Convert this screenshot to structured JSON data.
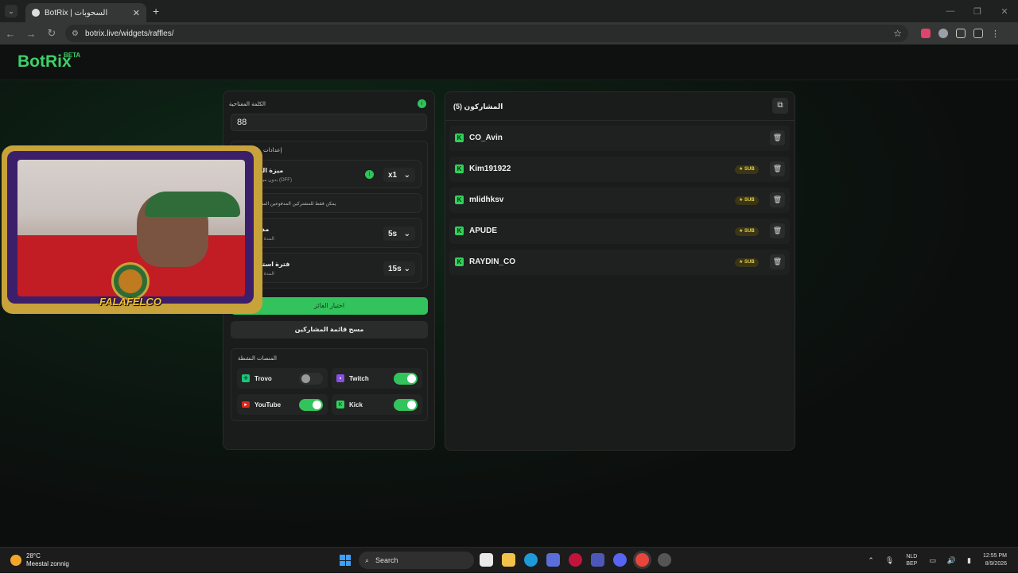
{
  "browser": {
    "tab_title": "BotRix | السحوبات",
    "url": "botrix.live/widgets/raffles/"
  },
  "app": {
    "logo": "BotRix",
    "logo_badge": "BETA"
  },
  "left_panel": {
    "keyword_label": "الكلمة المفتاحية",
    "keyword_value": "88",
    "settings_label": "إعدادات",
    "feature_title": "ميزة الم",
    "feature_sub": "بدون ميزة (OFF)",
    "feature_select": "x1",
    "paid_note": "يمكن فقط للمشتركين المدفوعين المشا",
    "duration_title": "مدة",
    "duration_sub": "المدة ال",
    "duration_select": "5s",
    "claim_title": "فترة استلا",
    "claim_sub": "المدة ال",
    "claim_select": "15s",
    "pick_winner": "اختيار الفائز",
    "clear_list": "مسح قائمة المشاركين",
    "platforms_label": "المنصات النشطة",
    "platforms": [
      {
        "name": "Trovo",
        "on": false
      },
      {
        "name": "Twitch",
        "on": true
      },
      {
        "name": "YouTube",
        "on": true
      },
      {
        "name": "Kick",
        "on": true
      }
    ]
  },
  "right_panel": {
    "title": "المشاركون (5)",
    "participants": [
      {
        "name": "CO_Avin",
        "sub": false
      },
      {
        "name": "Kim191922",
        "sub": true
      },
      {
        "name": "mlidhksv",
        "sub": true
      },
      {
        "name": "APUDE",
        "sub": true
      },
      {
        "name": "RAYDIN_CO",
        "sub": true
      }
    ],
    "sub_label": "SUB"
  },
  "overlay": {
    "brand": "FALAFELCO"
  },
  "taskbar": {
    "temp": "28°C",
    "weather": "Meestal zonnig",
    "search": "Search",
    "lang1": "NLD",
    "lang2": "BEP",
    "time": "12:55 PM",
    "date": "8/9/2026"
  },
  "colors": {
    "accent": "#32c35c",
    "sub_badge": "#e3d04a"
  }
}
